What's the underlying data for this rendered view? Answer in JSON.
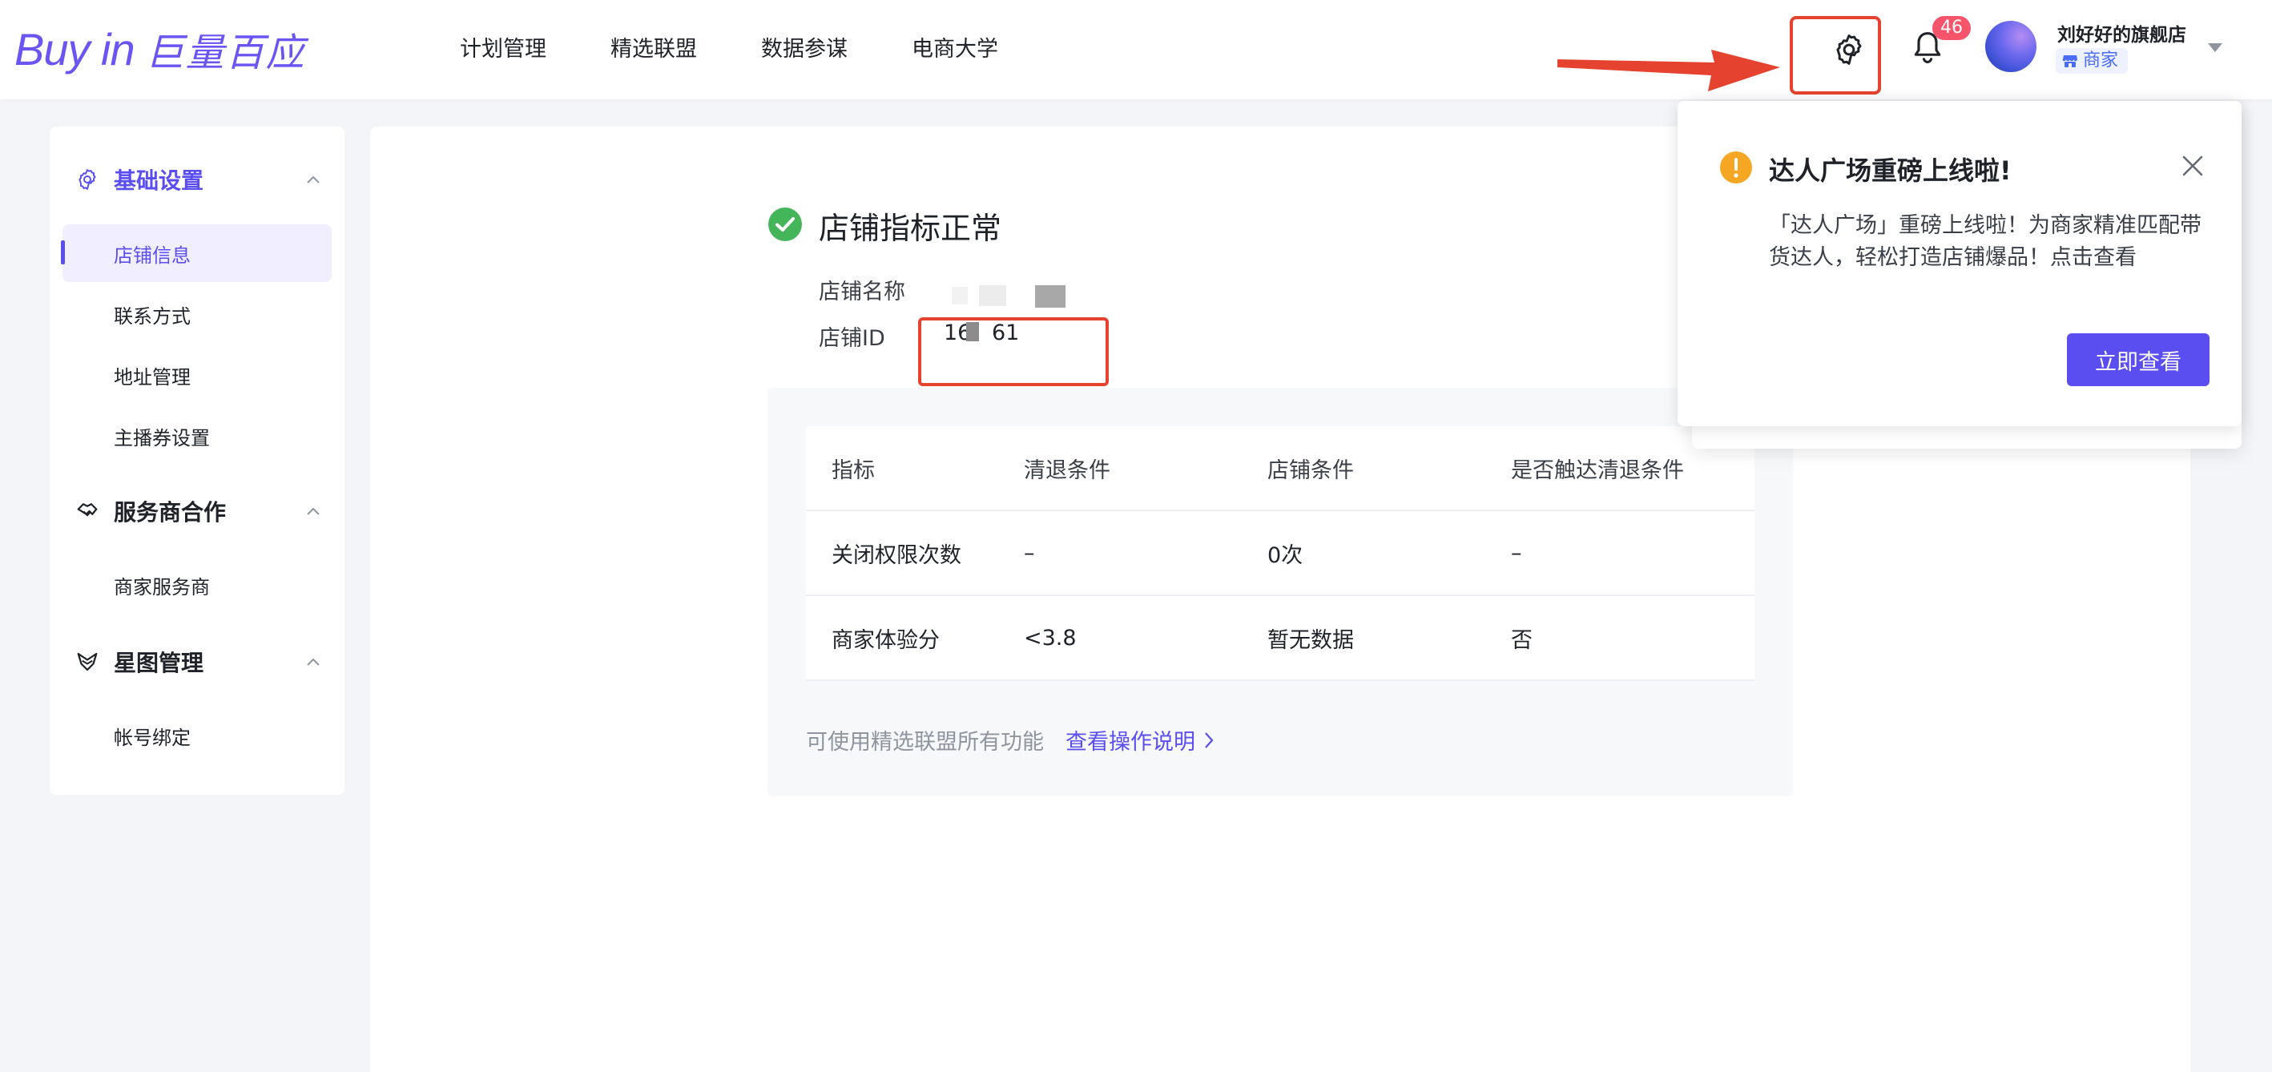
{
  "brand": {
    "logo_en": "Buy in",
    "logo_cn": "巨量百应",
    "accent_color": "#5b4ef0"
  },
  "top_nav": {
    "items": [
      "计划管理",
      "精选联盟",
      "数据参谋",
      "电商大学"
    ]
  },
  "header": {
    "notification_count": "46",
    "store_name": "刘好好的旗舰店",
    "role": "商家",
    "icons": [
      "gear-icon",
      "bell-icon",
      "chevron-down-icon"
    ]
  },
  "sidebar": {
    "groups": [
      {
        "label": "基础设置",
        "icon": "gear-icon",
        "items": [
          "店铺信息",
          "联系方式",
          "地址管理",
          "主播券设置"
        ]
      },
      {
        "label": "服务商合作",
        "icon": "handshake-icon",
        "items": [
          "商家服务商"
        ]
      },
      {
        "label": "星图管理",
        "icon": "star-map-icon",
        "items": [
          "帐号绑定"
        ]
      }
    ],
    "selected_item": "店铺信息"
  },
  "main": {
    "status_title": "店铺指标正常",
    "store_name_label": "店铺名称",
    "store_id_label": "店铺ID",
    "store_id_value_a": "16",
    "store_id_value_b": "61",
    "table": {
      "headers": [
        "指标",
        "清退条件",
        "店铺条件",
        "是否触达清退条件"
      ],
      "rows": [
        [
          "关闭权限次数",
          "–",
          "0次",
          "–"
        ],
        [
          "商家体验分",
          "<3.8",
          "暂无数据",
          "否"
        ]
      ]
    },
    "footer_note": "可使用精选联盟所有功能",
    "footer_link": "查看操作说明"
  },
  "popover": {
    "title": "达人广场重磅上线啦!",
    "body": "「达人广场」重磅上线啦！为商家精准匹配带货达人，轻松打造店铺爆品！点击查看",
    "button": "立即查看"
  }
}
